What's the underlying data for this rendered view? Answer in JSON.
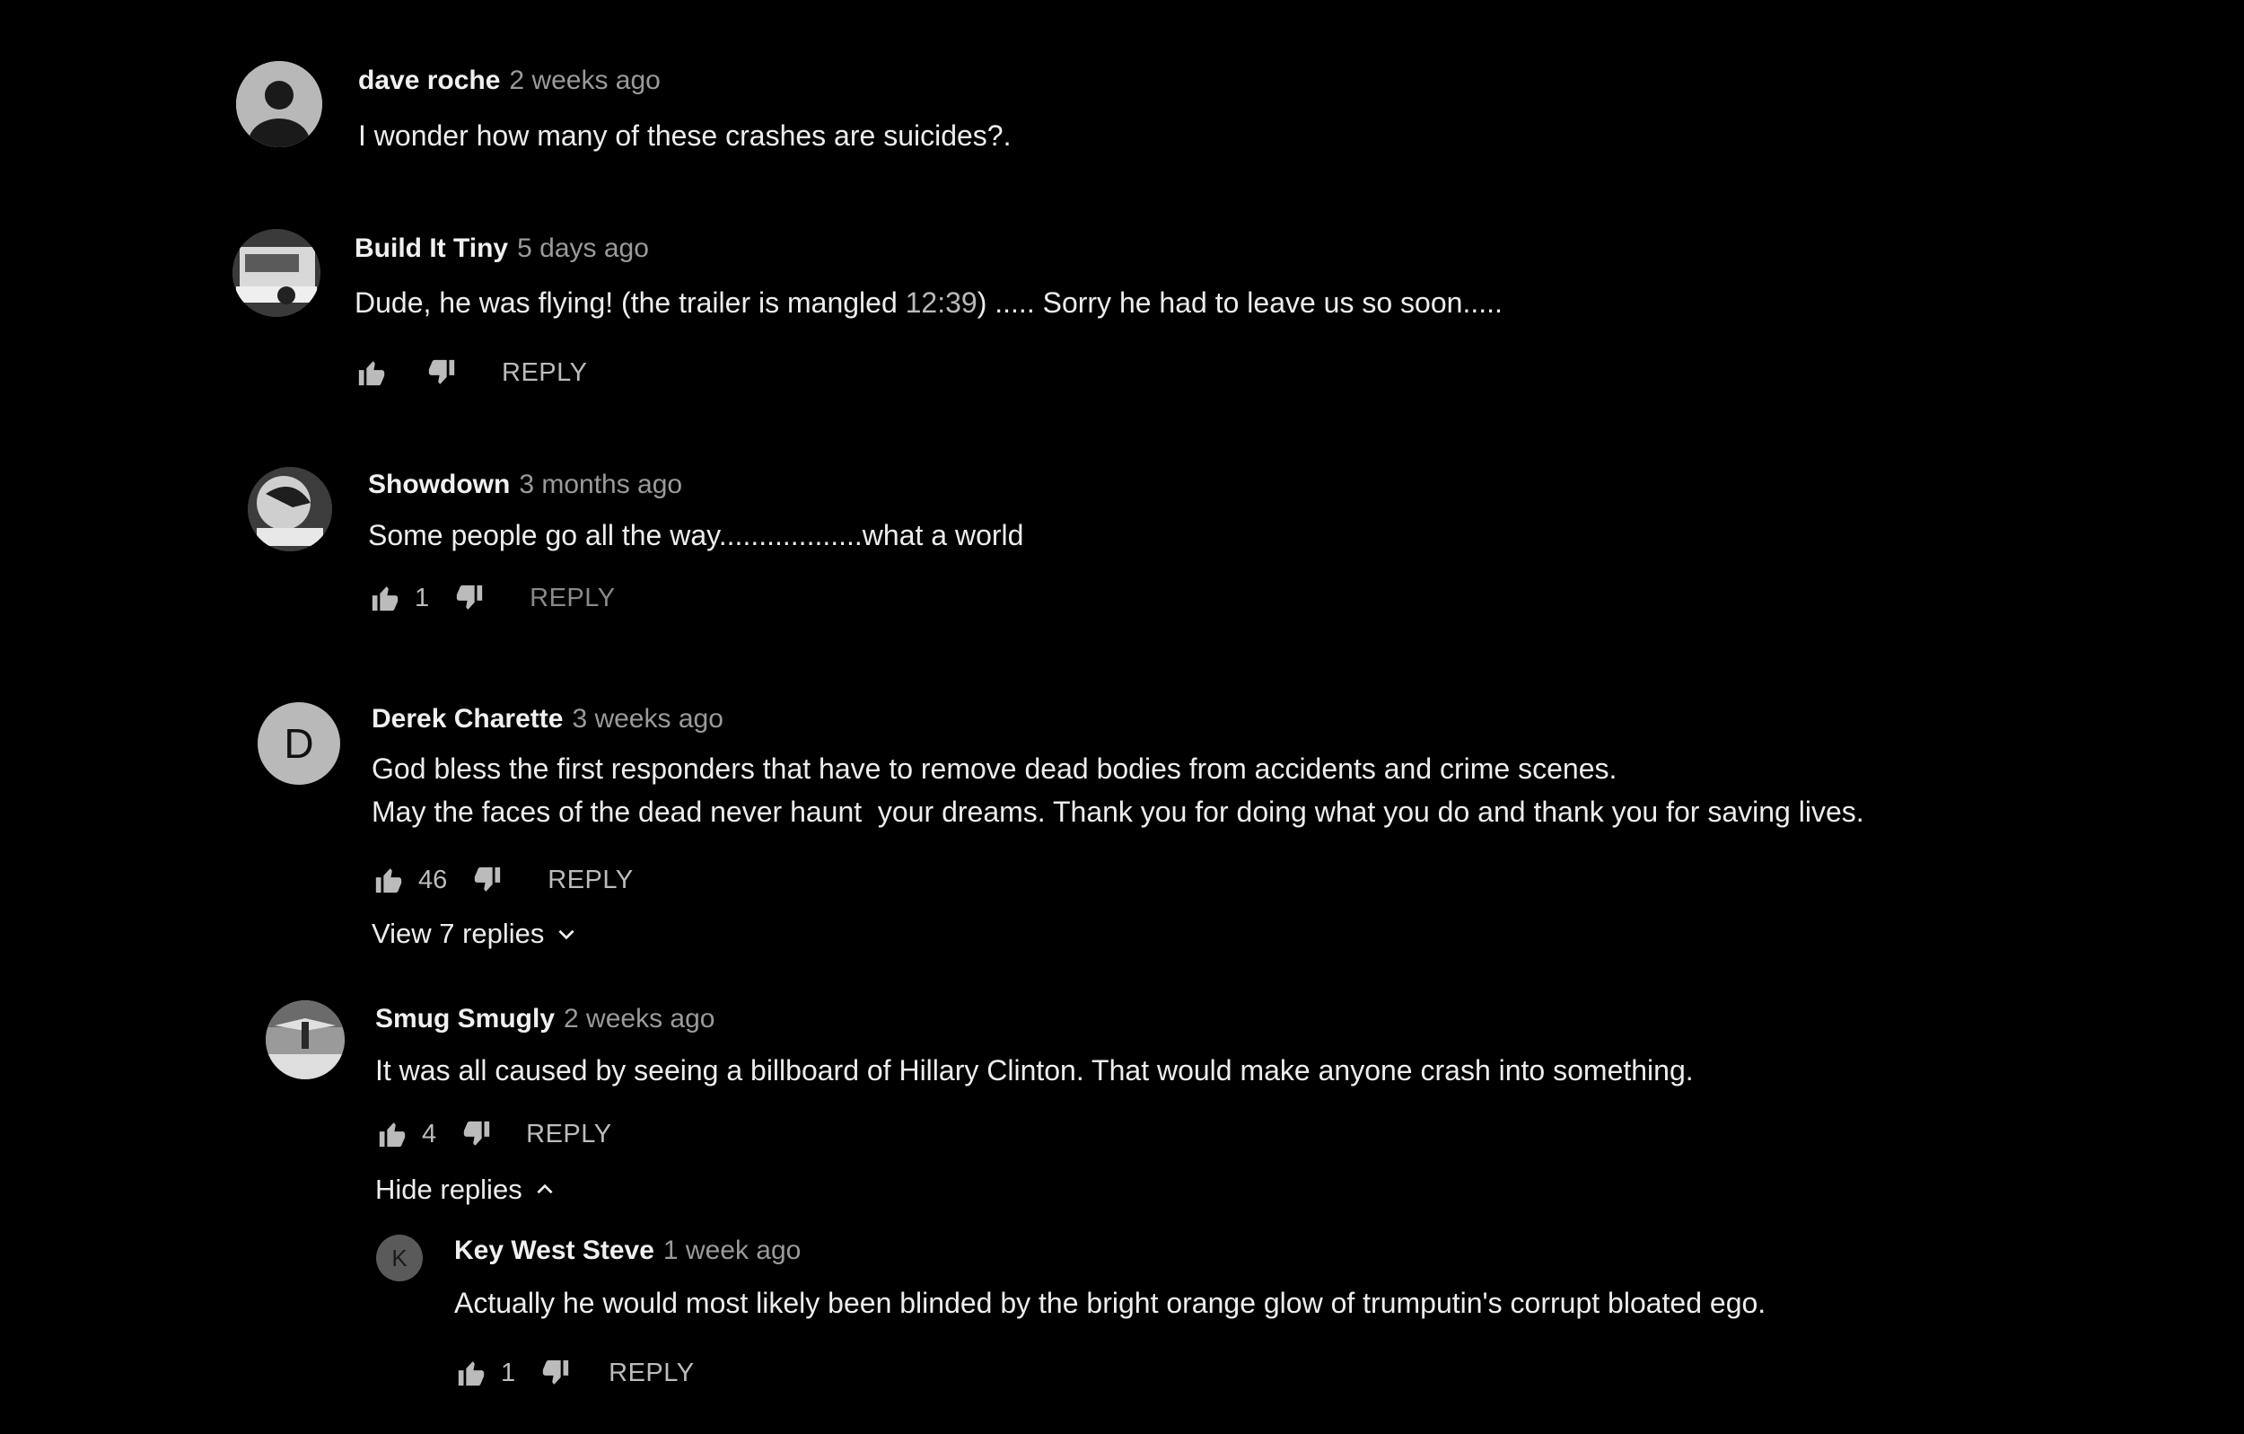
{
  "comments": [
    {
      "author": "dave roche",
      "time": "2 weeks ago",
      "text": "I wonder how many of these crashes are suicides?."
    },
    {
      "author": "Build It Tiny",
      "time": "5 days ago",
      "text_before": "Dude, he was flying! (the trailer is mangled ",
      "timestamp_link": "12:39",
      "text_after": ") ..... Sorry he had to leave us so soon.....",
      "reply_label": "REPLY"
    },
    {
      "author": "Showdown",
      "time": "3 months ago",
      "text": "Some people go all the way..................what a world",
      "likes": "1",
      "reply_label": "REPLY"
    },
    {
      "author": "Derek Charette",
      "time": "3 weeks ago",
      "avatar_letter": "D",
      "text_line1": "God bless the first responders that have to remove dead bodies from accidents and crime scenes.",
      "text_line2": "May the faces of the dead never haunt  your dreams. Thank you for doing what you do and thank you for saving lives.",
      "likes": "46",
      "reply_label": "REPLY",
      "view_replies_label": "View 7 replies"
    },
    {
      "author": "Smug Smugly",
      "time": "2 weeks ago",
      "text": "It was all caused by seeing a billboard of Hillary Clinton. That would make anyone crash into something.",
      "likes": "4",
      "reply_label": "REPLY",
      "hide_replies_label": "Hide replies",
      "replies": [
        {
          "author": "Key West Steve",
          "time": "1 week ago",
          "avatar_letter": "K",
          "text": "Actually he would most likely been blinded by the bright orange glow of trumputin's corrupt bloated ego.",
          "likes": "1",
          "reply_label": "REPLY"
        }
      ]
    }
  ],
  "icons": {
    "like": "thumb-up-icon",
    "dislike": "thumb-down-icon",
    "expand": "chevron-down-icon",
    "collapse": "chevron-up-icon"
  },
  "colors": {
    "background": "#000000",
    "text": "#ededed",
    "secondary": "#9a9a9a"
  }
}
